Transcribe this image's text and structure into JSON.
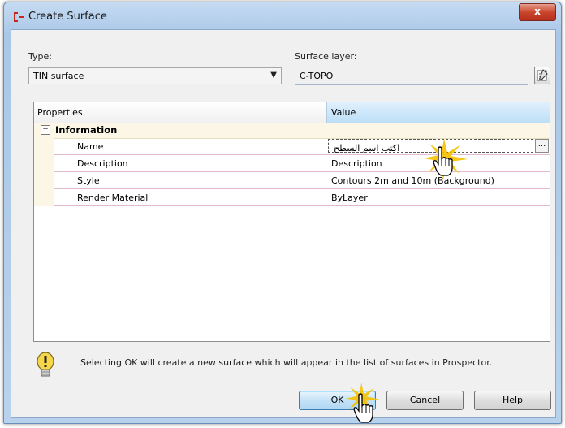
{
  "window": {
    "title": "Create Surface",
    "close_label": "x"
  },
  "type_field": {
    "label": "Type:",
    "value": "TIN surface"
  },
  "surface_layer": {
    "label": "Surface layer:",
    "value": "C-TOPO"
  },
  "grid": {
    "col_properties": "Properties",
    "col_value": "Value",
    "category": {
      "toggle": "⊟",
      "label": "Information"
    },
    "rows": [
      {
        "name": "Name",
        "value": "اكتب اسم السطح"
      },
      {
        "name": "Description",
        "value": "Description"
      },
      {
        "name": "Style",
        "value": "Contours 2m and 10m (Background)"
      },
      {
        "name": "Render Material",
        "value": "ByLayer"
      }
    ],
    "ellipsis": "..."
  },
  "info_message": "Selecting OK will create a new surface which will appear in the list of surfaces in Prospector.",
  "buttons": {
    "ok": "OK",
    "cancel": "Cancel",
    "help": "Help"
  },
  "colors": {
    "title_bar": "#b8d2ee",
    "close": "#c9452c",
    "value_header": "#bcdff7",
    "category_bg": "#fbf6e6",
    "row_line": "#e3b9d0",
    "sparkle": "#f5c000"
  },
  "icons": [
    "civil-app-icon",
    "close-icon",
    "dropdown-arrow-icon",
    "layer-picker-icon",
    "collapse-icon",
    "warning-bulb-icon",
    "hand-cursor-icon",
    "sparkle-icon"
  ]
}
